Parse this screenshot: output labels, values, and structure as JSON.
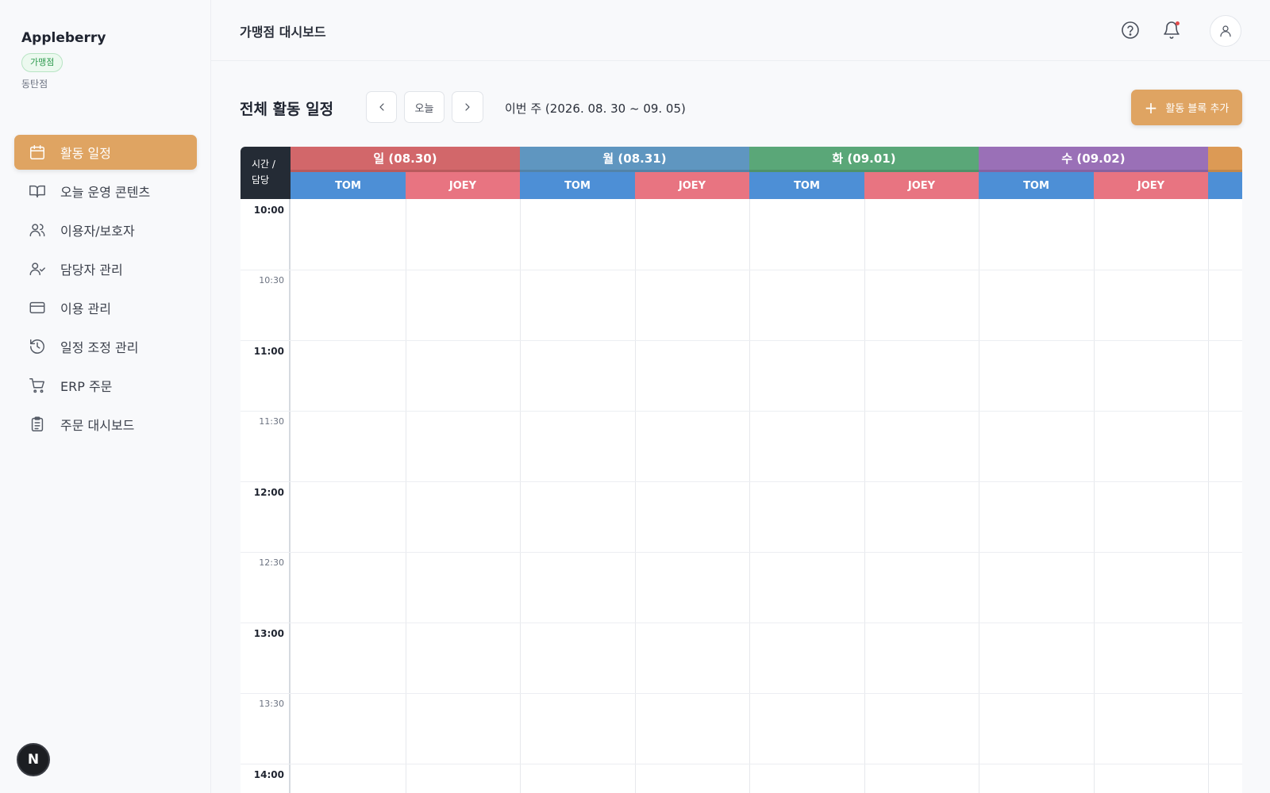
{
  "sidebar": {
    "brand": "Appleberry",
    "badge": "가맹점",
    "store": "동탄점",
    "items": [
      {
        "label": "활동 일정",
        "icon": "calendar-icon",
        "active": true
      },
      {
        "label": "오늘 운영 콘텐츠",
        "icon": "book-icon",
        "active": false
      },
      {
        "label": "이용자/보호자",
        "icon": "users-icon",
        "active": false
      },
      {
        "label": "담당자 관리",
        "icon": "user-check-icon",
        "active": false
      },
      {
        "label": "이용 관리",
        "icon": "credit-card-icon",
        "active": false
      },
      {
        "label": "일정 조정 관리",
        "icon": "history-icon",
        "active": false
      },
      {
        "label": "ERP 주문",
        "icon": "cart-icon",
        "active": false
      },
      {
        "label": "주문 대시보드",
        "icon": "clipboard-icon",
        "active": false
      }
    ],
    "n_button": "N"
  },
  "header": {
    "title": "가맹점 대시보드"
  },
  "toolbar": {
    "title": "전체 활동 일정",
    "today_label": "오늘",
    "week_range": "이번 주 (2026. 08. 30 ~ 09. 05)",
    "add_label": "활동 블록 추가"
  },
  "calendar": {
    "corner_line1": "시간 /",
    "corner_line2": "담당",
    "days": [
      {
        "label": "일 (08.30)",
        "color": "#d2676a"
      },
      {
        "label": "월 (08.31)",
        "color": "#5f96c0"
      },
      {
        "label": "화 (09.01)",
        "color": "#5aa778"
      },
      {
        "label": "수 (09.02)",
        "color": "#9a70b7"
      },
      {
        "label": "",
        "color": "#dc9a55"
      }
    ],
    "staff": [
      "TOM",
      "JOEY"
    ],
    "times": [
      "10:00",
      "10:30",
      "11:00",
      "11:30",
      "12:00",
      "12:30",
      "13:00",
      "13:30",
      "14:00"
    ]
  },
  "colors": {
    "accent": "#dfa462",
    "tom": "#4d8fd6",
    "joey": "#e87481"
  }
}
